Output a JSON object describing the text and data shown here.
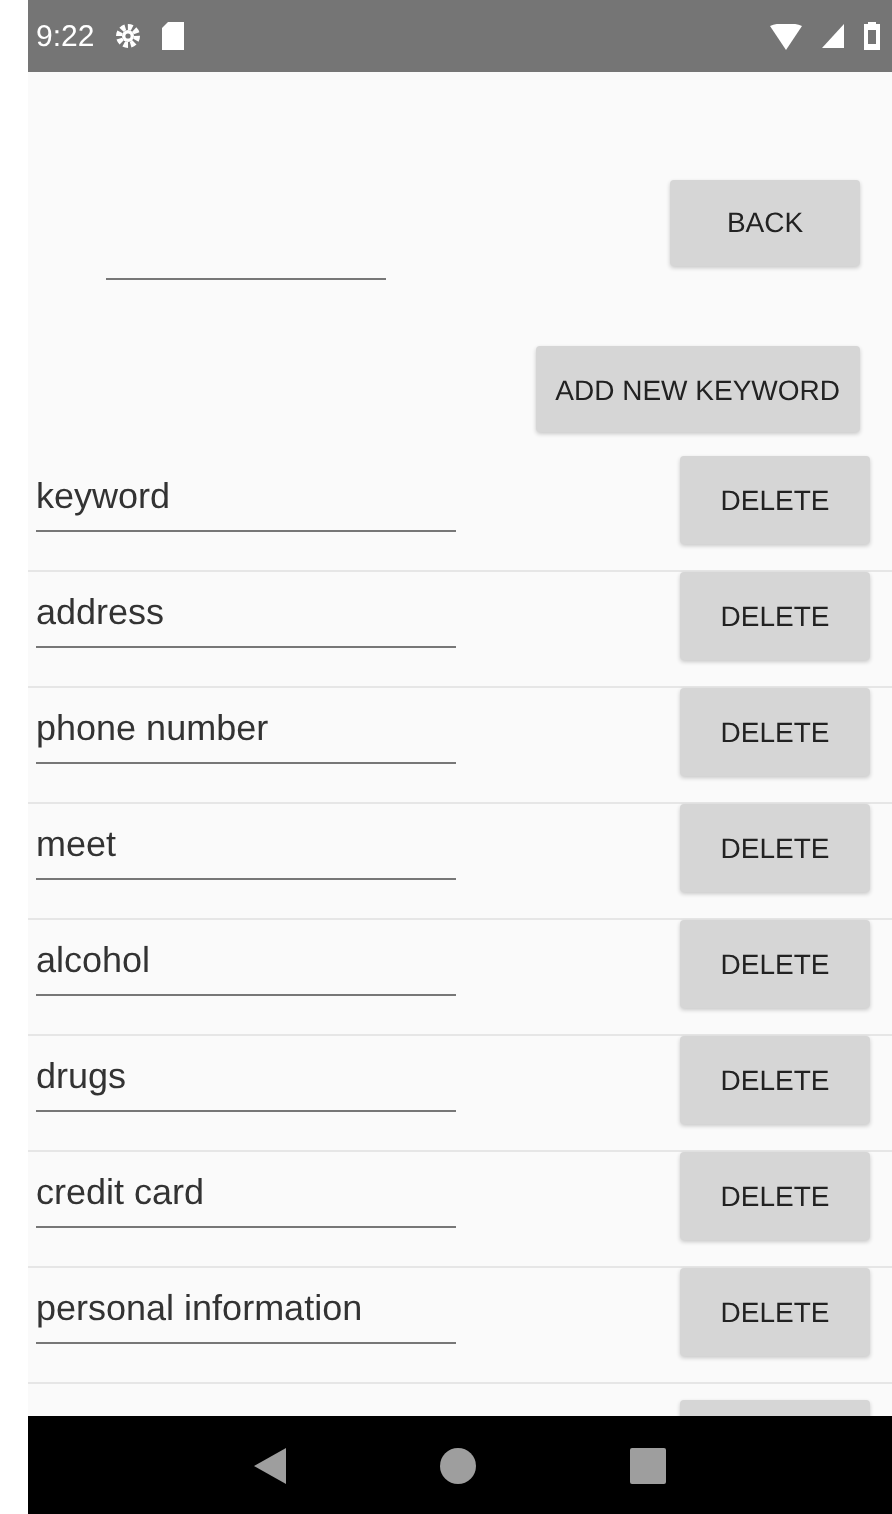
{
  "status_bar": {
    "time": "9:22"
  },
  "top": {
    "back_button": "BACK",
    "add_button": "ADD NEW KEYWORD"
  },
  "keywords": [
    {
      "value": "keyword",
      "button": "DELETE"
    },
    {
      "value": "address",
      "button": "DELETE"
    },
    {
      "value": "phone number",
      "button": "DELETE"
    },
    {
      "value": "meet",
      "button": "DELETE"
    },
    {
      "value": "alcohol",
      "button": "DELETE"
    },
    {
      "value": "drugs",
      "button": "DELETE"
    },
    {
      "value": "credit card",
      "button": "DELETE"
    },
    {
      "value": "personal information",
      "button": "DELETE"
    }
  ]
}
